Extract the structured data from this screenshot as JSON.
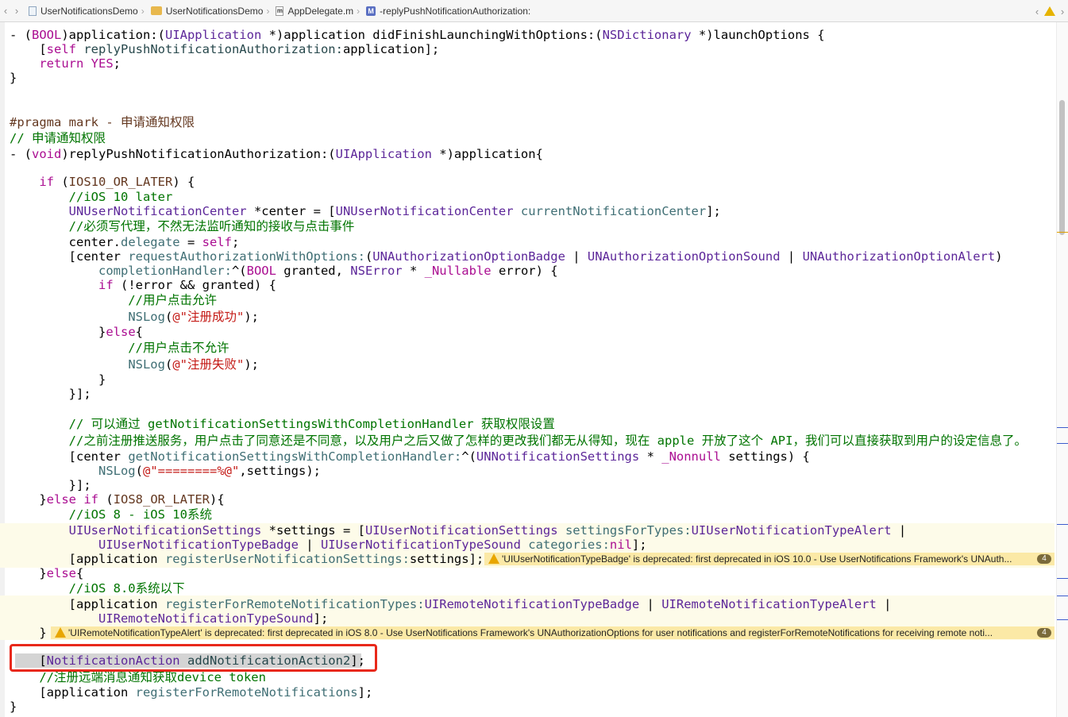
{
  "jumpbar": {
    "back_arrow": "‹",
    "forward_arrow": "›",
    "crumbs": [
      "UserNotificationsDemo",
      "UserNotificationsDemo",
      "AppDelegate.m",
      "-replyPushNotificationAuthorization:"
    ],
    "mfile_letter": "m",
    "method_badge": "M",
    "right_back": "‹",
    "right_forward": "›"
  },
  "warnings": {
    "w1_text": "'UIUserNotificationTypeBadge' is deprecated: first deprecated in iOS 10.0 - Use UserNotifications Framework's UNAuth...",
    "w1_count": "4",
    "w2_text": "'UIRemoteNotificationTypeAlert' is deprecated: first deprecated in iOS 8.0 - Use UserNotifications Framework's UNAuthorizationOptions for user notifications and registerForRemoteNotifications for receiving remote noti...",
    "w2_count": "4"
  },
  "colors": {
    "keyword": "#aa0d91",
    "type": "#5c2699",
    "method": "#3f6e74",
    "comment": "#007400",
    "string": "#c41a16",
    "warning": "#fbe9a6",
    "highlight": "#e8281a"
  },
  "code": {
    "l1": [
      [
        "- (",
        "n"
      ],
      [
        "BOOL",
        "kw"
      ],
      [
        ")application:(",
        "n"
      ],
      [
        "UIApplication",
        "ty"
      ],
      [
        " *)application didFinishLaunchingWithOptions:(",
        "n"
      ],
      [
        "NSDictionary",
        "ty"
      ],
      [
        " *)launchOptions {",
        "n"
      ]
    ],
    "l2": [
      [
        "    [",
        "n"
      ],
      [
        "self",
        "kw"
      ],
      [
        " replyPushNotificationAuthorization:",
        "mt2"
      ],
      [
        "application];",
        "n"
      ]
    ],
    "l3": [
      [
        "    ",
        "n"
      ],
      [
        "return",
        "kw"
      ],
      [
        " ",
        "n"
      ],
      [
        "YES",
        "kw"
      ],
      [
        ";",
        "n"
      ]
    ],
    "l4": [
      [
        "}",
        "n"
      ]
    ],
    "l5": [
      [
        "#pragma mark - 申请通知权限",
        "pp"
      ]
    ],
    "l6": [
      [
        "// 申请通知权限",
        "cm"
      ]
    ],
    "l7": [
      [
        "- (",
        "n"
      ],
      [
        "void",
        "kw"
      ],
      [
        ")replyPushNotificationAuthorization:(",
        "n"
      ],
      [
        "UIApplication",
        "ty"
      ],
      [
        " *)application{",
        "n"
      ]
    ],
    "l8": [
      [
        "    ",
        "n"
      ],
      [
        "if",
        "kw"
      ],
      [
        " (",
        "n"
      ],
      [
        "IOS10_OR_LATER",
        "mc"
      ],
      [
        ") {",
        "n"
      ]
    ],
    "l9": [
      [
        "        //iOS 10 later",
        "cm"
      ]
    ],
    "l10": [
      [
        "        ",
        "n"
      ],
      [
        "UNUserNotificationCenter",
        "ty"
      ],
      [
        " *center = [",
        "n"
      ],
      [
        "UNUserNotificationCenter",
        "ty"
      ],
      [
        " ",
        "n"
      ],
      [
        "currentNotificationCenter",
        "mt"
      ],
      [
        "];",
        "n"
      ]
    ],
    "l11": [
      [
        "        //必须写代理，不然无法监听通知的接收与点击事件",
        "cm"
      ]
    ],
    "l12": [
      [
        "        center.",
        "n"
      ],
      [
        "delegate",
        "mt"
      ],
      [
        " = ",
        "n"
      ],
      [
        "self",
        "kw"
      ],
      [
        ";",
        "n"
      ]
    ],
    "l13": [
      [
        "        [center ",
        "n"
      ],
      [
        "requestAuthorizationWithOptions:",
        "mt"
      ],
      [
        "(",
        "n"
      ],
      [
        "UNAuthorizationOptionBadge",
        "ty"
      ],
      [
        " | ",
        "n"
      ],
      [
        "UNAuthorizationOptionSound",
        "ty"
      ],
      [
        " | ",
        "n"
      ],
      [
        "UNAuthorizationOptionAlert",
        "ty"
      ],
      [
        ")",
        "n"
      ]
    ],
    "l14": [
      [
        "            ",
        "n"
      ],
      [
        "completionHandler:",
        "mt"
      ],
      [
        "^(",
        "n"
      ],
      [
        "BOOL",
        "kw"
      ],
      [
        " granted, ",
        "n"
      ],
      [
        "NSError",
        "ty"
      ],
      [
        " * ",
        "n"
      ],
      [
        "_Nullable",
        "kw"
      ],
      [
        " error) {",
        "n"
      ]
    ],
    "l15": [
      [
        "            ",
        "n"
      ],
      [
        "if",
        "kw"
      ],
      [
        " (!error && granted) {",
        "n"
      ]
    ],
    "l16": [
      [
        "                //用户点击允许",
        "cm"
      ]
    ],
    "l17": [
      [
        "                ",
        "n"
      ],
      [
        "NSLog",
        "mt"
      ],
      [
        "(",
        "n"
      ],
      [
        "@\"注册成功\"",
        "st"
      ],
      [
        ");",
        "n"
      ]
    ],
    "l18": [
      [
        "            }",
        "n"
      ],
      [
        "else",
        "kw"
      ],
      [
        "{",
        "n"
      ]
    ],
    "l19": [
      [
        "                //用户点击不允许",
        "cm"
      ]
    ],
    "l20": [
      [
        "                ",
        "n"
      ],
      [
        "NSLog",
        "mt"
      ],
      [
        "(",
        "n"
      ],
      [
        "@\"注册失败\"",
        "st"
      ],
      [
        ");",
        "n"
      ]
    ],
    "l21": [
      [
        "            }",
        "n"
      ]
    ],
    "l22": [
      [
        "        }];",
        "n"
      ]
    ],
    "l23": [
      [
        "        // 可以通过 getNotificationSettingsWithCompletionHandler 获取权限设置",
        "cm"
      ]
    ],
    "l24": [
      [
        "        //之前注册推送服务，用户点击了同意还是不同意，以及用户之后又做了怎样的更改我们都无从得知，现在 apple 开放了这个 API，我们可以直接获取到用户的设定信息了。",
        "cm"
      ]
    ],
    "l25": [
      [
        "        [center ",
        "n"
      ],
      [
        "getNotificationSettingsWithCompletionHandler:",
        "mt"
      ],
      [
        "^(",
        "n"
      ],
      [
        "UNNotificationSettings",
        "ty"
      ],
      [
        " * ",
        "n"
      ],
      [
        "_Nonnull",
        "kw"
      ],
      [
        " settings) {",
        "n"
      ]
    ],
    "l26": [
      [
        "            ",
        "n"
      ],
      [
        "NSLog",
        "mt"
      ],
      [
        "(",
        "n"
      ],
      [
        "@\"========%@\"",
        "st"
      ],
      [
        ",settings);",
        "n"
      ]
    ],
    "l27": [
      [
        "        }];",
        "n"
      ]
    ],
    "l28": [
      [
        "    }",
        "n"
      ],
      [
        "else",
        "kw"
      ],
      [
        " ",
        "n"
      ],
      [
        "if",
        "kw"
      ],
      [
        " (",
        "n"
      ],
      [
        "IOS8_OR_LATER",
        "mc"
      ],
      [
        "){",
        "n"
      ]
    ],
    "l29": [
      [
        "        //iOS 8 - iOS 10系统",
        "cm"
      ]
    ],
    "l30": [
      [
        "        ",
        "n"
      ],
      [
        "UIUserNotificationSettings",
        "ty"
      ],
      [
        " *settings = [",
        "n"
      ],
      [
        "UIUserNotificationSettings",
        "ty"
      ],
      [
        " ",
        "n"
      ],
      [
        "settingsForTypes:",
        "mt"
      ],
      [
        "UIUserNotificationTypeAlert",
        "ty"
      ],
      [
        " |",
        "n"
      ]
    ],
    "l31": [
      [
        "            ",
        "n"
      ],
      [
        "UIUserNotificationTypeBadge",
        "ty"
      ],
      [
        " | ",
        "n"
      ],
      [
        "UIUserNotificationTypeSound",
        "ty"
      ],
      [
        " ",
        "n"
      ],
      [
        "categories:",
        "mt"
      ],
      [
        "nil",
        "kw"
      ],
      [
        "];",
        "n"
      ]
    ],
    "l32": [
      [
        "        [application ",
        "n"
      ],
      [
        "registerUserNotificationSettings:",
        "mt"
      ],
      [
        "settings];",
        "n"
      ]
    ],
    "l33": [
      [
        "    }",
        "n"
      ],
      [
        "else",
        "kw"
      ],
      [
        "{",
        "n"
      ]
    ],
    "l34": [
      [
        "        //iOS 8.0系统以下",
        "cm"
      ]
    ],
    "l35": [
      [
        "        [application ",
        "n"
      ],
      [
        "registerForRemoteNotificationTypes:",
        "mt"
      ],
      [
        "UIRemoteNotificationTypeBadge",
        "ty"
      ],
      [
        " | ",
        "n"
      ],
      [
        "UIRemoteNotificationTypeAlert",
        "ty"
      ],
      [
        " |",
        "n"
      ]
    ],
    "l36": [
      [
        "            ",
        "n"
      ],
      [
        "UIRemoteNotificationTypeSound",
        "ty"
      ],
      [
        "];",
        "n"
      ]
    ],
    "l37": [
      [
        "    }",
        "n"
      ]
    ],
    "l38": [
      [
        "    [",
        "n"
      ],
      [
        "NotificationAction",
        "ty"
      ],
      [
        " ",
        "n"
      ],
      [
        "addNotificationAction2",
        "mt2"
      ],
      [
        "];",
        "n"
      ]
    ],
    "l39": [
      [
        "    //注册远端消息通知获取device token",
        "cm"
      ]
    ],
    "l40": [
      [
        "    [application ",
        "n"
      ],
      [
        "registerForRemoteNotifications",
        "mt"
      ],
      [
        "];",
        "n"
      ]
    ],
    "l41": [
      [
        "}",
        "n"
      ]
    ]
  }
}
